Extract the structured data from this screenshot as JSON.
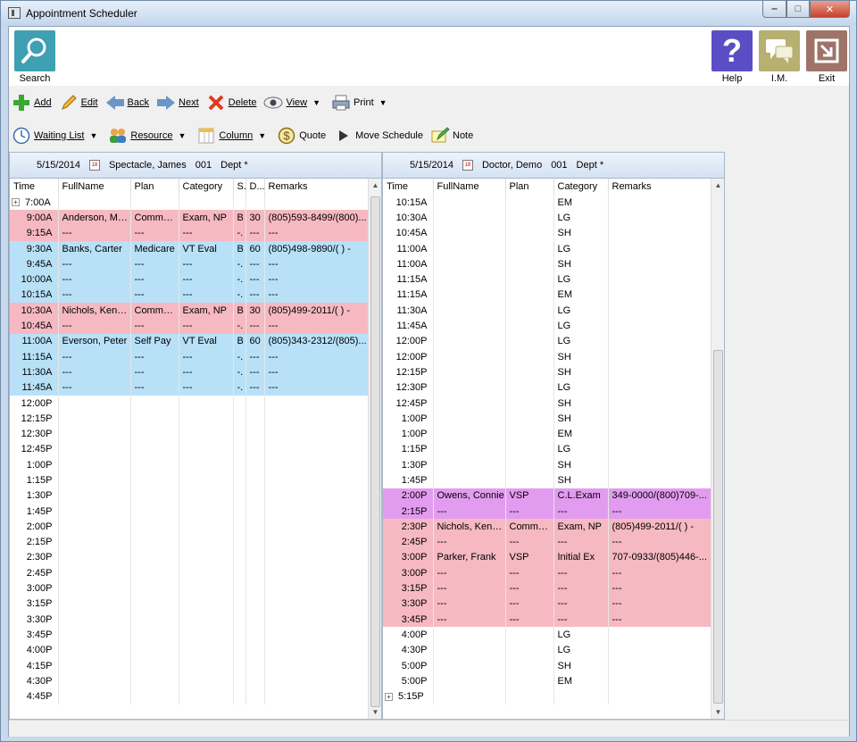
{
  "window": {
    "title": "Appointment Scheduler",
    "minimize": "‒",
    "maximize": "□",
    "close": "✕"
  },
  "topbar": {
    "search_label": "Search",
    "help_label": "Help",
    "help_glyph": "?",
    "im_label": "I.M.",
    "exit_label": "Exit"
  },
  "toolbar1": {
    "add": "Add",
    "edit": "Edit",
    "back": "Back",
    "next": "Next",
    "delete": "Delete",
    "view": "View",
    "print": "Print"
  },
  "toolbar2": {
    "waiting_list": "Waiting List",
    "resource": "Resource",
    "column": "Column",
    "quote": "Quote",
    "move_schedule": "Move Schedule",
    "note": "Note"
  },
  "left_pane": {
    "date": "5/15/2014",
    "provider": "Spectacle, James",
    "code": "001",
    "dept": "Dept *",
    "columns": [
      "Time",
      "FullName",
      "Plan",
      "Category",
      "S.",
      "D...",
      "Remarks"
    ],
    "rows": [
      {
        "time": "7:00A",
        "expand": "+",
        "name": "",
        "plan": "",
        "cat": "",
        "s": "",
        "d": "",
        "rem": "",
        "color": ""
      },
      {
        "time": "9:00A",
        "name": "Anderson, Molly",
        "plan": "Commer...",
        "cat": "Exam, NP",
        "s": "B",
        "d": "30",
        "rem": "(805)593-8499/(800)...",
        "color": "pink"
      },
      {
        "time": "9:15A",
        "name": "---",
        "plan": "---",
        "cat": "---",
        "s": "-.",
        "d": "---",
        "rem": "---",
        "color": "pink"
      },
      {
        "time": "9:30A",
        "name": "Banks, Carter",
        "plan": "Medicare",
        "cat": "VT Eval",
        "s": "B",
        "d": "60",
        "rem": "(805)498-9890/(  )  -",
        "color": "blue"
      },
      {
        "time": "9:45A",
        "name": "---",
        "plan": "---",
        "cat": "---",
        "s": "-.",
        "d": "---",
        "rem": "---",
        "color": "blue"
      },
      {
        "time": "10:00A",
        "name": "---",
        "plan": "---",
        "cat": "---",
        "s": "-.",
        "d": "---",
        "rem": "---",
        "color": "blue"
      },
      {
        "time": "10:15A",
        "name": "---",
        "plan": "---",
        "cat": "---",
        "s": "-.",
        "d": "---",
        "rem": "---",
        "color": "blue"
      },
      {
        "time": "10:30A",
        "name": "Nichols, Kendra",
        "plan": "Commer...",
        "cat": "Exam, NP",
        "s": "B",
        "d": "30",
        "rem": "(805)499-2011/(  )  -",
        "color": "pink"
      },
      {
        "time": "10:45A",
        "name": "---",
        "plan": "---",
        "cat": "---",
        "s": "-.",
        "d": "---",
        "rem": "---",
        "color": "pink"
      },
      {
        "time": "11:00A",
        "name": "Everson, Peter",
        "plan": "Self Pay",
        "cat": "VT Eval",
        "s": "B",
        "d": "60",
        "rem": "(805)343-2312/(805)...",
        "color": "blue"
      },
      {
        "time": "11:15A",
        "name": "---",
        "plan": "---",
        "cat": "---",
        "s": "-.",
        "d": "---",
        "rem": "---",
        "color": "blue"
      },
      {
        "time": "11:30A",
        "name": "---",
        "plan": "---",
        "cat": "---",
        "s": "-.",
        "d": "---",
        "rem": "---",
        "color": "blue"
      },
      {
        "time": "11:45A",
        "name": "---",
        "plan": "---",
        "cat": "---",
        "s": "-.",
        "d": "---",
        "rem": "---",
        "color": "blue"
      },
      {
        "time": "12:00P",
        "name": "",
        "plan": "",
        "cat": "",
        "s": "",
        "d": "",
        "rem": "",
        "color": ""
      },
      {
        "time": "12:15P",
        "name": "",
        "plan": "",
        "cat": "",
        "s": "",
        "d": "",
        "rem": "",
        "color": ""
      },
      {
        "time": "12:30P",
        "name": "",
        "plan": "",
        "cat": "",
        "s": "",
        "d": "",
        "rem": "",
        "color": ""
      },
      {
        "time": "12:45P",
        "name": "",
        "plan": "",
        "cat": "",
        "s": "",
        "d": "",
        "rem": "",
        "color": ""
      },
      {
        "time": "1:00P",
        "name": "",
        "plan": "",
        "cat": "",
        "s": "",
        "d": "",
        "rem": "",
        "color": ""
      },
      {
        "time": "1:15P",
        "name": "",
        "plan": "",
        "cat": "",
        "s": "",
        "d": "",
        "rem": "",
        "color": ""
      },
      {
        "time": "1:30P",
        "name": "",
        "plan": "",
        "cat": "",
        "s": "",
        "d": "",
        "rem": "",
        "color": ""
      },
      {
        "time": "1:45P",
        "name": "",
        "plan": "",
        "cat": "",
        "s": "",
        "d": "",
        "rem": "",
        "color": ""
      },
      {
        "time": "2:00P",
        "name": "",
        "plan": "",
        "cat": "",
        "s": "",
        "d": "",
        "rem": "",
        "color": ""
      },
      {
        "time": "2:15P",
        "name": "",
        "plan": "",
        "cat": "",
        "s": "",
        "d": "",
        "rem": "",
        "color": ""
      },
      {
        "time": "2:30P",
        "name": "",
        "plan": "",
        "cat": "",
        "s": "",
        "d": "",
        "rem": "",
        "color": ""
      },
      {
        "time": "2:45P",
        "name": "",
        "plan": "",
        "cat": "",
        "s": "",
        "d": "",
        "rem": "",
        "color": ""
      },
      {
        "time": "3:00P",
        "name": "",
        "plan": "",
        "cat": "",
        "s": "",
        "d": "",
        "rem": "",
        "color": ""
      },
      {
        "time": "3:15P",
        "name": "",
        "plan": "",
        "cat": "",
        "s": "",
        "d": "",
        "rem": "",
        "color": ""
      },
      {
        "time": "3:30P",
        "name": "",
        "plan": "",
        "cat": "",
        "s": "",
        "d": "",
        "rem": "",
        "color": ""
      },
      {
        "time": "3:45P",
        "name": "",
        "plan": "",
        "cat": "",
        "s": "",
        "d": "",
        "rem": "",
        "color": ""
      },
      {
        "time": "4:00P",
        "name": "",
        "plan": "",
        "cat": "",
        "s": "",
        "d": "",
        "rem": "",
        "color": ""
      },
      {
        "time": "4:15P",
        "name": "",
        "plan": "",
        "cat": "",
        "s": "",
        "d": "",
        "rem": "",
        "color": ""
      },
      {
        "time": "4:30P",
        "name": "",
        "plan": "",
        "cat": "",
        "s": "",
        "d": "",
        "rem": "",
        "color": ""
      },
      {
        "time": "4:45P",
        "name": "",
        "plan": "",
        "cat": "",
        "s": "",
        "d": "",
        "rem": "",
        "color": ""
      }
    ]
  },
  "right_pane": {
    "date": "5/15/2014",
    "provider": "Doctor, Demo",
    "code": "001",
    "dept": "Dept *",
    "columns": [
      "Time",
      "FullName",
      "Plan",
      "Category",
      "Remarks"
    ],
    "rows": [
      {
        "time": "10:15A",
        "name": "",
        "plan": "",
        "cat": "EM",
        "rem": "",
        "color": ""
      },
      {
        "time": "10:30A",
        "name": "",
        "plan": "",
        "cat": "LG",
        "rem": "",
        "color": ""
      },
      {
        "time": "10:45A",
        "name": "",
        "plan": "",
        "cat": "SH",
        "rem": "",
        "color": ""
      },
      {
        "time": "11:00A",
        "name": "",
        "plan": "",
        "cat": "LG",
        "rem": "",
        "color": ""
      },
      {
        "time": "11:00A",
        "name": "",
        "plan": "",
        "cat": "SH",
        "rem": "",
        "color": ""
      },
      {
        "time": "11:15A",
        "name": "",
        "plan": "",
        "cat": "LG",
        "rem": "",
        "color": ""
      },
      {
        "time": "11:15A",
        "name": "",
        "plan": "",
        "cat": "EM",
        "rem": "",
        "color": ""
      },
      {
        "time": "11:30A",
        "name": "",
        "plan": "",
        "cat": "LG",
        "rem": "",
        "color": ""
      },
      {
        "time": "11:45A",
        "name": "",
        "plan": "",
        "cat": "LG",
        "rem": "",
        "color": ""
      },
      {
        "time": "12:00P",
        "name": "",
        "plan": "",
        "cat": "LG",
        "rem": "",
        "color": ""
      },
      {
        "time": "12:00P",
        "name": "",
        "plan": "",
        "cat": "SH",
        "rem": "",
        "color": ""
      },
      {
        "time": "12:15P",
        "name": "",
        "plan": "",
        "cat": "SH",
        "rem": "",
        "color": ""
      },
      {
        "time": "12:30P",
        "name": "",
        "plan": "",
        "cat": "LG",
        "rem": "",
        "color": ""
      },
      {
        "time": "12:45P",
        "name": "",
        "plan": "",
        "cat": "SH",
        "rem": "",
        "color": ""
      },
      {
        "time": "1:00P",
        "name": "",
        "plan": "",
        "cat": "SH",
        "rem": "",
        "color": ""
      },
      {
        "time": "1:00P",
        "name": "",
        "plan": "",
        "cat": "EM",
        "rem": "",
        "color": ""
      },
      {
        "time": "1:15P",
        "name": "",
        "plan": "",
        "cat": "LG",
        "rem": "",
        "color": ""
      },
      {
        "time": "1:30P",
        "name": "",
        "plan": "",
        "cat": "SH",
        "rem": "",
        "color": ""
      },
      {
        "time": "1:45P",
        "name": "",
        "plan": "",
        "cat": "SH",
        "rem": "",
        "color": ""
      },
      {
        "time": "2:00P",
        "name": "Owens, Connie",
        "plan": "VSP",
        "cat": "C.L.Exam",
        "rem": "349-0000/(800)709-...",
        "color": "purple"
      },
      {
        "time": "2:15P",
        "name": "---",
        "plan": "---",
        "cat": "---",
        "rem": "---",
        "color": "purple"
      },
      {
        "time": "2:30P",
        "name": "Nichols, Kendra",
        "plan": "Commer...",
        "cat": "Exam, NP",
        "rem": "(805)499-2011/(  )  -",
        "color": "pink"
      },
      {
        "time": "2:45P",
        "name": "---",
        "plan": "---",
        "cat": "---",
        "rem": "---",
        "color": "pink"
      },
      {
        "time": "3:00P",
        "name": "Parker, Frank",
        "plan": "VSP",
        "cat": "Initial Ex",
        "rem": "707-0933/(805)446-...",
        "color": "pink"
      },
      {
        "time": "3:00P",
        "name": "---",
        "plan": "---",
        "cat": "---",
        "rem": "---",
        "color": "pink"
      },
      {
        "time": "3:15P",
        "name": "---",
        "plan": "---",
        "cat": "---",
        "rem": "---",
        "color": "pink"
      },
      {
        "time": "3:30P",
        "name": "---",
        "plan": "---",
        "cat": "---",
        "rem": "---",
        "color": "pink"
      },
      {
        "time": "3:45P",
        "name": "---",
        "plan": "---",
        "cat": "---",
        "rem": "---",
        "color": "pink"
      },
      {
        "time": "4:00P",
        "name": "",
        "plan": "",
        "cat": "LG",
        "rem": "",
        "color": ""
      },
      {
        "time": "4:30P",
        "name": "",
        "plan": "",
        "cat": "LG",
        "rem": "",
        "color": ""
      },
      {
        "time": "5:00P",
        "name": "",
        "plan": "",
        "cat": "SH",
        "rem": "",
        "color": ""
      },
      {
        "time": "5:00P",
        "name": "",
        "plan": "",
        "cat": "EM",
        "rem": "",
        "color": ""
      },
      {
        "time": "5:15P",
        "expand": "+",
        "name": "",
        "plan": "",
        "cat": "",
        "rem": "",
        "color": ""
      }
    ]
  },
  "colors": {
    "pink": "#f6b9c2",
    "blue": "#b8e1f8",
    "purple": "#e29cef",
    "header_blue": "#d4e2f2"
  }
}
